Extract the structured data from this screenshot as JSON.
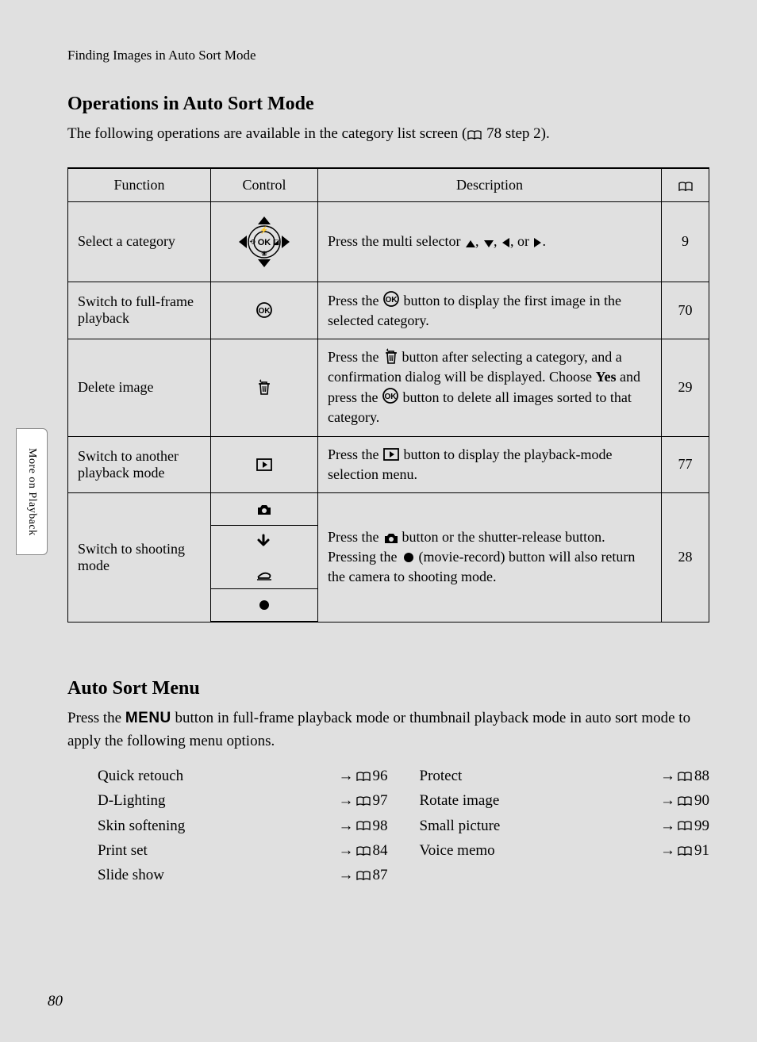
{
  "running_head": "Finding Images in Auto Sort Mode",
  "heading1": "Operations in Auto Sort Mode",
  "intro_pre": "The following operations are available in the category list screen (",
  "intro_post": " 78 step 2).",
  "th_function": "Function",
  "th_control": "Control",
  "th_description": "Description",
  "rows": {
    "r1": {
      "func": "Select a category",
      "desc_pre": "Press the multi selector ",
      "desc_post": ".",
      "page": "9"
    },
    "r2": {
      "func": "Switch to full-frame playback",
      "desc_pre": "Press the ",
      "desc_post": " button to display the first image in the selected category.",
      "page": "70"
    },
    "r3": {
      "func": "Delete image",
      "d1": "Press the ",
      "d2": " button after selecting a category, and a confirmation dialog will be displayed. Choose ",
      "d3": "Yes",
      "d4": " and press the ",
      "d5": " button to delete all images sorted to that category.",
      "page": "29"
    },
    "r4": {
      "func": "Switch to another playback mode",
      "desc_pre": "Press the ",
      "desc_post": " button to display the playback-mode selection menu.",
      "page": "77"
    },
    "r5": {
      "func": "Switch to shooting mode",
      "d1": "Press the ",
      "d2": " button or the shutter-release button. Pressing the ",
      "d3": " (movie-record) button will also return the camera to shooting mode.",
      "page": "28"
    }
  },
  "heading2": "Auto Sort Menu",
  "menu_intro_pre": "Press the ",
  "menu_label": "MENU",
  "menu_intro_post": " button in full-frame playback mode or thumbnail playback mode in auto sort mode to apply the following menu options.",
  "menu_left": [
    {
      "name": "Quick retouch",
      "page": "96"
    },
    {
      "name": "D-Lighting",
      "page": "97"
    },
    {
      "name": "Skin softening",
      "page": "98"
    },
    {
      "name": "Print set",
      "page": "84"
    },
    {
      "name": "Slide show",
      "page": "87"
    }
  ],
  "menu_right": [
    {
      "name": "Protect",
      "page": "88"
    },
    {
      "name": "Rotate image",
      "page": "90"
    },
    {
      "name": "Small picture",
      "page": "99"
    },
    {
      "name": "Voice memo",
      "page": "91"
    }
  ],
  "side_tab": "More on Playback",
  "page_number": "80",
  "or_word": " or ",
  "comma": ", "
}
